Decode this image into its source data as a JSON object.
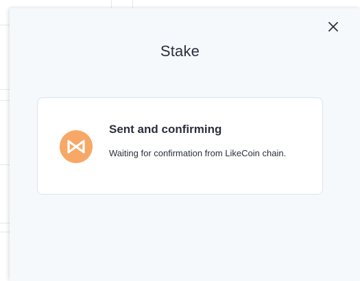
{
  "modal": {
    "title": "Stake",
    "close_icon": "close-icon"
  },
  "status": {
    "icon": "likecoin-icon",
    "icon_color": "#f7a866",
    "heading": "Sent and confirming",
    "message": "Waiting for confirmation from LikeCoin chain."
  }
}
